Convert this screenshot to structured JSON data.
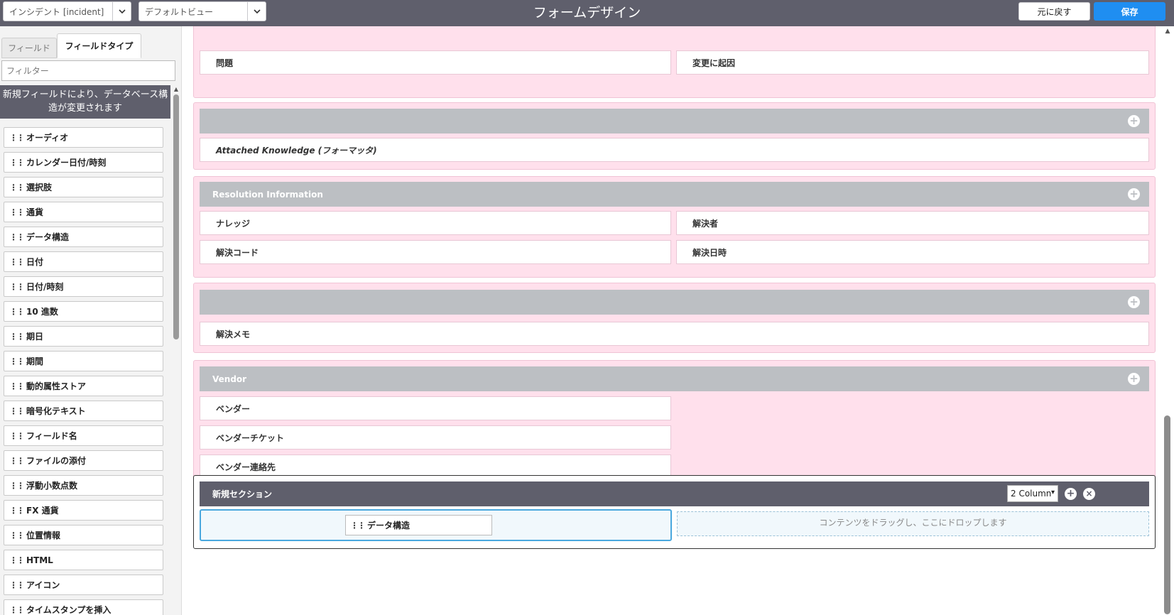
{
  "header": {
    "table_select": "インシデント [incident]",
    "view_select": "デフォルトビュー",
    "title": "フォームデザイン",
    "revert_label": "元に戻す",
    "save_label": "保存"
  },
  "sidebar": {
    "tabs": [
      {
        "label": "フィールド",
        "active": false
      },
      {
        "label": "フィールドタイプ",
        "active": true
      }
    ],
    "filter_placeholder": "フィルター",
    "notice": "新規フィールドにより、データベース構造が変更されます",
    "items": [
      "オーディオ",
      "カレンダー日付/時刻",
      "選択肢",
      "通貨",
      "データ構造",
      "日付",
      "日付/時刻",
      "10 進数",
      "期日",
      "期間",
      "動的属性ストア",
      "暗号化テキスト",
      "フィールド名",
      "ファイルの添付",
      "浮動小数点数",
      "FX 通貨",
      "位置情報",
      "HTML",
      "アイコン",
      "タイムスタンプを挿入"
    ]
  },
  "form": {
    "top_section": {
      "fields": [
        "問題",
        "変更に起因"
      ]
    },
    "knowledge_section": {
      "title": "",
      "fields": [
        "Attached Knowledge (フォーマッタ)"
      ]
    },
    "resolution_section": {
      "title": "Resolution Information",
      "fields": [
        "ナレッジ",
        "解決者",
        "解決コード",
        "解決日時"
      ]
    },
    "notes_section": {
      "title": "",
      "fields": [
        "解決メモ"
      ]
    },
    "vendor_section": {
      "title": "Vendor",
      "fields": [
        "ベンダー",
        "ベンダーチケット",
        "ベンダー連絡先"
      ]
    },
    "new_section": {
      "title": "新規セクション",
      "columns_select": "2 Column",
      "dragged_field": "データ構造",
      "drop_hint": "コンテンツをドラッグし、ここにドロップします"
    }
  },
  "colors": {
    "header_bg": "#5f5f6c",
    "save_button": "#1f8ef1",
    "section_bg": "#ffe0ec",
    "section_header": "#bcbfc3",
    "drop_highlight": "#4aa8de"
  }
}
